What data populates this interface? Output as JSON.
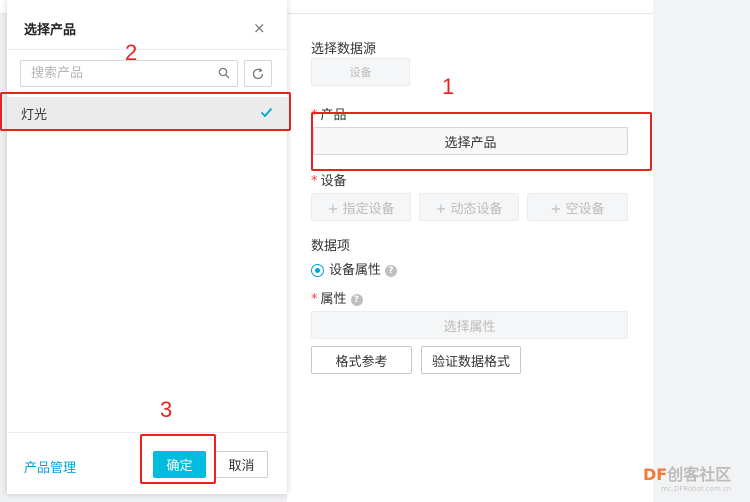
{
  "config": {
    "data_source_label": "选择数据源",
    "data_source_button": "设备",
    "product_label": "产品",
    "product_button": "选择产品",
    "device_label": "设备",
    "device_buttons": [
      "+ 指定设备",
      "+ 动态设备",
      "+ 空设备"
    ],
    "data_item_label": "数据项",
    "data_item_option": "设备属性",
    "property_label": "属性",
    "property_button": "选择属性",
    "format_ref_button": "格式参考",
    "validate_button": "验证数据格式",
    "required_mark": "*",
    "help_glyph": "?"
  },
  "dialog": {
    "title": "选择产品",
    "close_glyph": "×",
    "search_placeholder": "搜索产品",
    "products": [
      {
        "label": "灯光",
        "selected": true
      }
    ],
    "manage_link": "产品管理",
    "confirm_button": "确定",
    "cancel_button": "取消"
  },
  "annotations": {
    "step1": "1",
    "step2": "2",
    "step3": "3"
  },
  "watermark": {
    "brand_df": "DF",
    "brand_rest": "创客社区",
    "url": "mc.DFRobot.com.cn"
  },
  "colors": {
    "accent": "#00bde0",
    "link": "#00a6d6",
    "annotation_red": "#e8231e",
    "required_red": "#e8463d"
  }
}
